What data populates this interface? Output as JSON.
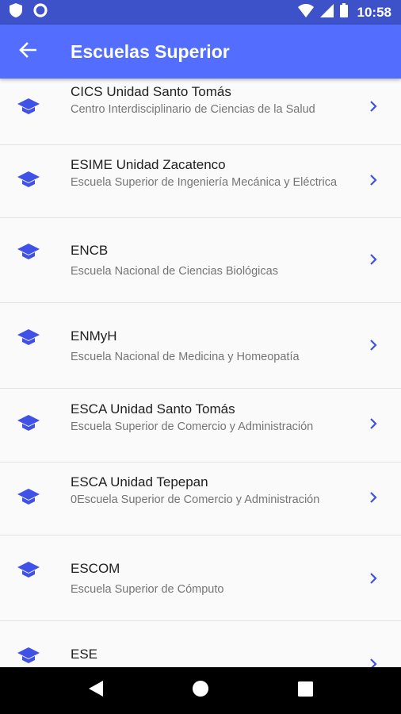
{
  "status_bar": {
    "time": "10:58",
    "icons": [
      "shield-icon",
      "circle-icon",
      "wifi-icon",
      "signal-icon",
      "battery-icon"
    ]
  },
  "app_bar": {
    "title": "Escuelas Superior",
    "back_icon": "arrow-left-icon"
  },
  "colors": {
    "status_bar": "#3d51c9",
    "app_bar": "#536dfe",
    "accent": "#3f51e6",
    "background": "#fafafa"
  },
  "schools": [
    {
      "title": "CICS Unidad Santo Tomás",
      "subtitle": "Centro Interdisciplinario de Ciencias de la Salud"
    },
    {
      "title": "ESIME Unidad Zacatenco",
      "subtitle": "Escuela Superior de Ingeniería Mecánica y Eléctrica"
    },
    {
      "title": "ENCB",
      "subtitle": "Escuela Nacional de Ciencias Biológicas"
    },
    {
      "title": "ENMyH",
      "subtitle": "Escuela Nacional de Medicina y Homeopatía"
    },
    {
      "title": "ESCA Unidad Santo Tomás",
      "subtitle": "Escuela Superior de Comercio y Administración"
    },
    {
      "title": "ESCA Unidad Tepepan",
      "subtitle": "0Escuela Superior de Comercio y Administración"
    },
    {
      "title": "ESCOM",
      "subtitle": "Escuela Superior de Cómputo"
    },
    {
      "title": "ESE",
      "subtitle": ""
    }
  ],
  "item_icon": "graduation-cap-icon",
  "item_action_icon": "chevron-right-icon",
  "nav_bar": {
    "icons": [
      "back-triangle-icon",
      "home-circle-icon",
      "recents-square-icon"
    ]
  }
}
